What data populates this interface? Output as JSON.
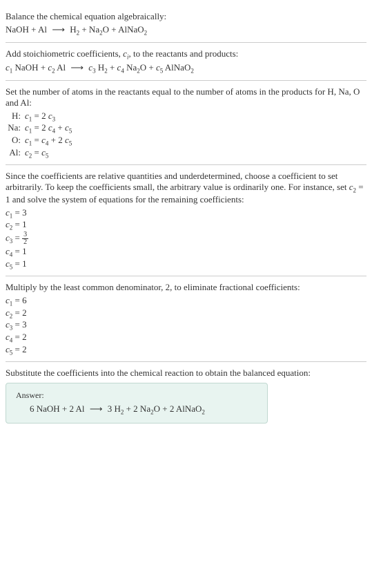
{
  "section1": {
    "intro": "Balance the chemical equation algebraically:",
    "equation": "NaOH + Al ⟶ H₂ + Na₂O + AlNaO₂"
  },
  "section2": {
    "intro": "Add stoichiometric coefficients, cᵢ, to the reactants and products:",
    "equation": "c₁ NaOH + c₂ Al ⟶ c₃ H₂ + c₄ Na₂O + c₅ AlNaO₂"
  },
  "section3": {
    "intro": "Set the number of atoms in the reactants equal to the number of atoms in the products for H, Na, O and Al:",
    "rows": [
      {
        "el": "H:",
        "eq": "c₁ = 2 c₃"
      },
      {
        "el": "Na:",
        "eq": "c₁ = 2 c₄ + c₅"
      },
      {
        "el": "O:",
        "eq": "c₁ = c₄ + 2 c₅"
      },
      {
        "el": "Al:",
        "eq": "c₂ = c₅"
      }
    ]
  },
  "section4": {
    "intro": "Since the coefficients are relative quantities and underdetermined, choose a coefficient to set arbitrarily. To keep the coefficients small, the arbitrary value is ordinarily one. For instance, set c₂ = 1 and solve the system of equations for the remaining coefficients:",
    "rows": [
      {
        "eq": "c₁ = 3"
      },
      {
        "eq": "c₂ = 1"
      },
      {
        "eq_html": "c₃ = ",
        "frac_num": "3",
        "frac_den": "2"
      },
      {
        "eq": "c₄ = 1"
      },
      {
        "eq": "c₅ = 1"
      }
    ]
  },
  "section5": {
    "intro": "Multiply by the least common denominator, 2, to eliminate fractional coefficients:",
    "rows": [
      {
        "eq": "c₁ = 6"
      },
      {
        "eq": "c₂ = 2"
      },
      {
        "eq": "c₃ = 3"
      },
      {
        "eq": "c₄ = 2"
      },
      {
        "eq": "c₅ = 2"
      }
    ]
  },
  "section6": {
    "intro": "Substitute the coefficients into the chemical reaction to obtain the balanced equation:",
    "answer_label": "Answer:",
    "answer_eq": "6 NaOH + 2 Al ⟶ 3 H₂ + 2 Na₂O + 2 AlNaO₂"
  }
}
